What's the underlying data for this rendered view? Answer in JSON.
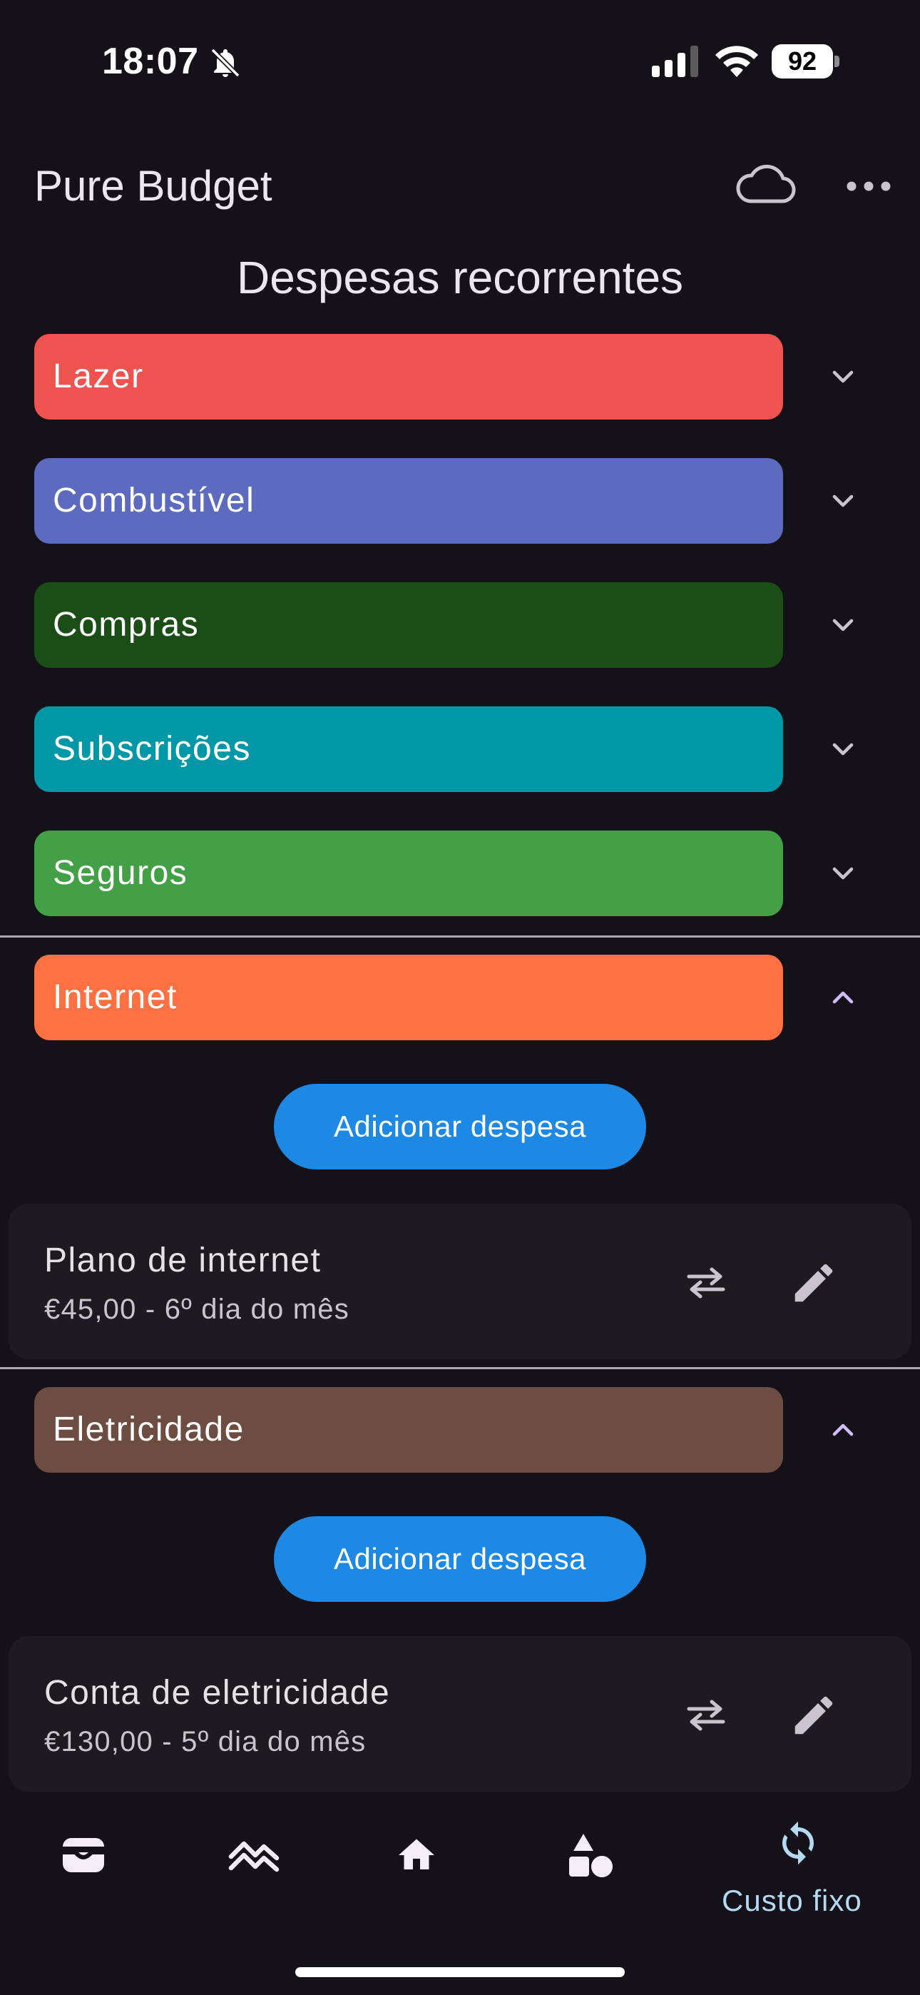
{
  "status_bar": {
    "time": "18:07",
    "battery": "92",
    "icons": [
      "bell-off-icon",
      "signal-icon",
      "wifi-icon",
      "battery-icon"
    ]
  },
  "app_bar": {
    "title": "Pure Budget",
    "actions": [
      "cloud-icon",
      "more-horizontal-icon"
    ]
  },
  "page": {
    "title": "Despesas recorrentes"
  },
  "categories": [
    {
      "label": "Lazer",
      "color": "#EF5350",
      "expanded": false
    },
    {
      "label": "Combustível",
      "color": "#5C6BC0",
      "expanded": false
    },
    {
      "label": "Compras",
      "color": "#1B4D16",
      "expanded": false
    },
    {
      "label": "Subscrições",
      "color": "#0097A7",
      "expanded": false
    },
    {
      "label": "Seguros",
      "color": "#43A047",
      "expanded": false
    },
    {
      "label": "Internet",
      "color": "#FF7043",
      "expanded": true,
      "add_button": "Adicionar despesa",
      "expenses": [
        {
          "name": "Plano de internet",
          "detail": "€45,00 - 6º dia do mês"
        }
      ]
    },
    {
      "label": "Eletricidade",
      "color": "#6D4C41",
      "expanded": true,
      "add_button": "Adicionar despesa",
      "expenses": [
        {
          "name": "Conta de eletricidade",
          "detail": "€130,00 - 5º dia do mês"
        }
      ]
    }
  ],
  "bottom_nav": {
    "items": [
      {
        "icon": "wallet-icon",
        "label": ""
      },
      {
        "icon": "trending-icon",
        "label": ""
      },
      {
        "icon": "home-icon",
        "label": ""
      },
      {
        "icon": "shapes-icon",
        "label": ""
      },
      {
        "icon": "sync-icon",
        "label": "Custo fixo",
        "selected": true
      }
    ]
  },
  "colors": {
    "background": "#141218",
    "accent_button": "#1E88E5",
    "selected_nav": "#B3DAF2",
    "card": "#1D1B20"
  }
}
